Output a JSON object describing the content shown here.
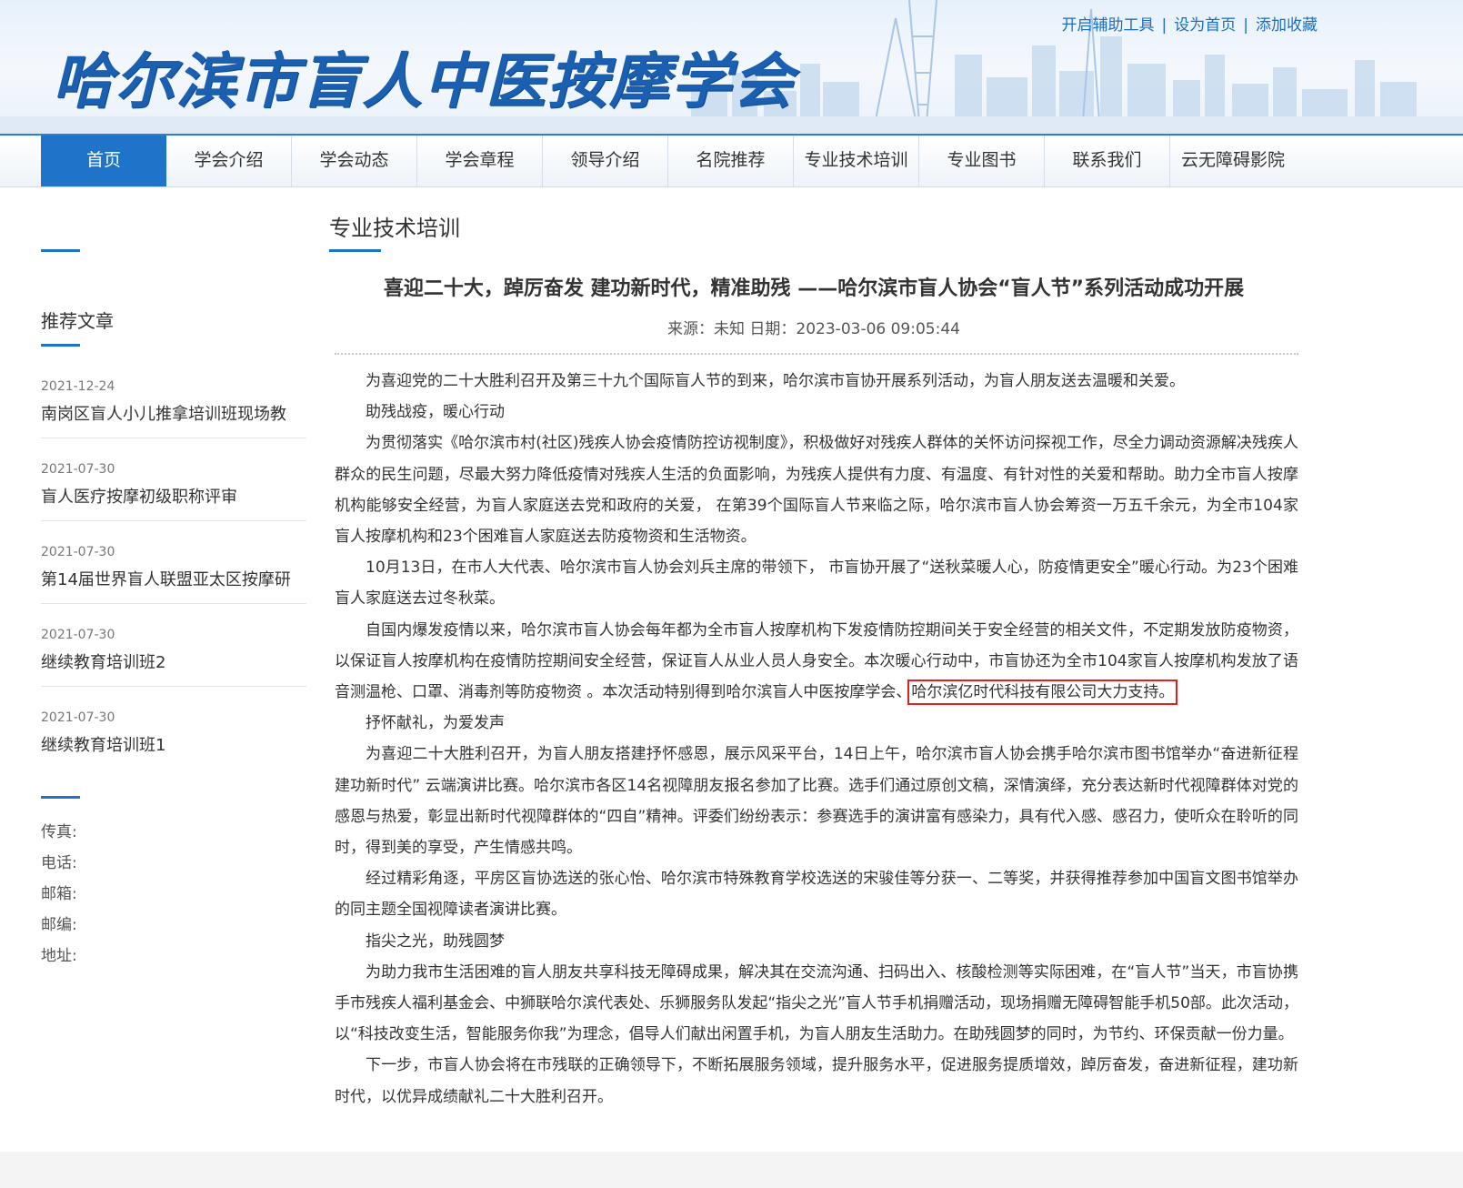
{
  "header": {
    "site_title": "哈尔滨市盲人中医按摩学会",
    "top_links": [
      "开启辅助工具",
      "设为首页",
      "添加收藏"
    ]
  },
  "nav": {
    "items": [
      "首页",
      "学会介绍",
      "学会动态",
      "学会章程",
      "领导介绍",
      "名院推荐",
      "专业技术培训",
      "专业图书",
      "联系我们",
      "云无障碍影院"
    ],
    "active_index": 0
  },
  "sidebar": {
    "heading": "推荐文章",
    "articles": [
      {
        "date": "2021-12-24",
        "title": "南岗区盲人小儿推拿培训班现场教"
      },
      {
        "date": "2021-07-30",
        "title": "盲人医疗按摩初级职称评审"
      },
      {
        "date": "2021-07-30",
        "title": "第14届世界盲人联盟亚太区按摩研"
      },
      {
        "date": "2021-07-30",
        "title": "继续教育培训班2"
      },
      {
        "date": "2021-07-30",
        "title": "继续教育培训班1"
      }
    ],
    "contact": [
      "传真:",
      "电话:",
      "邮箱:",
      "邮编:",
      "地址:"
    ]
  },
  "main": {
    "section_title": "专业技术培训",
    "article_title": "喜迎二十大，踔厉奋发 建功新时代，精准助残 ——哈尔滨市盲人协会“盲人节”系列活动成功开展",
    "meta": "来源：未知 日期：2023-03-06 09:05:44",
    "paragraphs": [
      "为喜迎党的二十大胜利召开及第三十九个国际盲人节的到来，哈尔滨市盲协开展系列活动，为盲人朋友送去温暖和关爱。",
      "助残战疫，暖心行动",
      "为贯彻落实《哈尔滨市村(社区)残疾人协会疫情防控访视制度》，积极做好对残疾人群体的关怀访问探视工作，尽全力调动资源解决残疾人群众的民生问题，尽最大努力降低疫情对残疾人生活的负面影响，为残疾人提供有力度、有温度、有针对性的关爱和帮助。助力全市盲人按摩机构能够安全经营，为盲人家庭送去党和政府的关爱， 在第39个国际盲人节来临之际，哈尔滨市盲人协会筹资一万五千余元，为全市104家盲人按摩机构和23个困难盲人家庭送去防疫物资和生活物资。",
      "10月13日，在市人大代表、哈尔滨市盲人协会刘兵主席的带领下， 市盲协开展了“送秋菜暖人心，防疫情更安全”暖心行动。为23个困难盲人家庭送去过冬秋菜。",
      "自国内爆发疫情以来，哈尔滨市盲人协会每年都为全市盲人按摩机构下发疫情防控期间关于安全经营的相关文件，不定期发放防疫物资，以保证盲人按摩机构在疫情防控期间安全经营，保证盲人从业人员人身安全。本次暖心行动中，市盲协还为全市104家盲人按摩机构发放了语音测温枪、口罩、消毒剂等防疫物资 。本次活动特别得到哈尔滨盲人中医按摩学会、",
      "抒怀献礼，为爱发声",
      "为喜迎二十大胜利召开，为盲人朋友搭建抒怀感恩，展示风采平台，14日上午，哈尔滨市盲人协会携手哈尔滨市图书馆举办“奋进新征程 建功新时代” 云端演讲比赛。哈尔滨市各区14名视障朋友报名参加了比赛。选手们通过原创文稿，深情演绎，充分表达新时代视障群体对党的感恩与热爱，彰显出新时代视障群体的“四自”精神。评委们纷纷表示：参赛选手的演讲富有感染力，具有代入感、感召力，使听众在聆听的同时，得到美的享受，产生情感共鸣。",
      "经过精彩角逐，平房区盲协选送的张心怡、哈尔滨市特殊教育学校选送的宋骏佳等分获一、二等奖，并获得推荐参加中国盲文图书馆举办的同主题全国视障读者演讲比赛。",
      "指尖之光，助残圆梦",
      "为助力我市生活困难的盲人朋友共享科技无障碍成果，解决其在交流沟通、扫码出入、核酸检测等实际困难，在“盲人节”当天，市盲协携手市残疾人福利基金会、中狮联哈尔滨代表处、乐狮服务队发起“指尖之光”盲人节手机捐赠活动，现场捐赠无障碍智能手机50部。此次活动，以“科技改变生活，智能服务你我”为理念，倡导人们献出闲置手机，为盲人朋友生活助力。在助残圆梦的同时，为节约、环保贡献一份力量。",
      "下一步，市盲人协会将在市残联的正确领导下，不断拓展服务领域，提升服务水平，促进服务提质增效，踔厉奋发，奋进新征程，建功新时代，以优异成绩献礼二十大胜利召开。"
    ],
    "highlight_text": "哈尔滨亿时代科技有限公司大力支持。"
  },
  "colors": {
    "brand_blue": "#1f73c9",
    "highlight_red": "#e0201f"
  }
}
